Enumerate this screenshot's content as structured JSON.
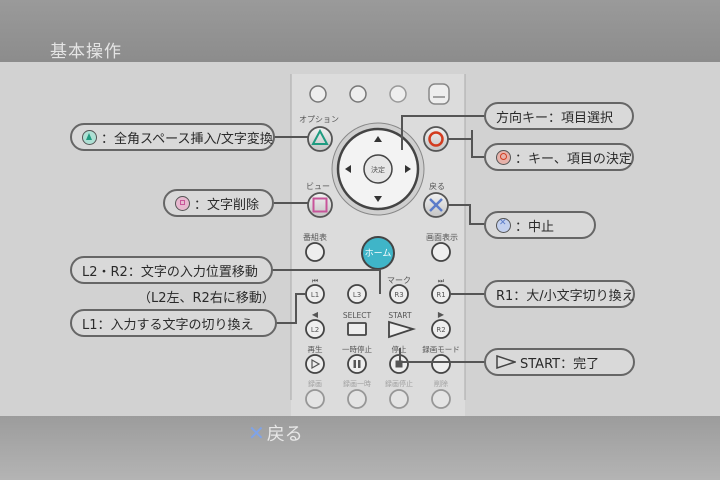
{
  "header": {
    "title": "基本操作"
  },
  "footer": {
    "back_label": "戻る",
    "back_icon": "cross-icon"
  },
  "remote": {
    "option_label": "オプション",
    "view_label": "ビュー",
    "back_label": "戻る",
    "guide_label": "番組表",
    "display_label": "画面表示",
    "home_label": "ホーム",
    "mark_label": "マーク",
    "enter_label": "決定",
    "select_label": "SELECT",
    "start_label": "START",
    "play_label": "再生",
    "pause_label": "一時停止",
    "stop_label": "停止",
    "record_mode_label": "録画モード",
    "rec_label": "録画",
    "rec_pause_label": "録画一時",
    "rec_stop_label": "録画停止",
    "delete_label": "削除",
    "l1": "L1",
    "l2": "L2",
    "l3": "L3",
    "r1": "R1",
    "r2": "R2",
    "r3": "R3"
  },
  "callouts": {
    "triangle": "：全角スペース挿入/文字変換",
    "square": "：文字削除",
    "l2r2": "L2・R2：文字の入力位置移動",
    "l2r2_note": "（L2左、R2右に移動）",
    "l1": "L1：入力する文字の切り換え",
    "dpad": "方向キー：項目選択",
    "circle": "：キー、項目の決定",
    "cross": "：中止",
    "r1": "R1：大/小文字切り換え",
    "start": "START：完了"
  },
  "colors": {
    "triangle": "#1f9b80",
    "circle": "#d33c1f",
    "square": "#c8559a",
    "cross": "#5c7cc9",
    "home": "#3fb5c8"
  }
}
